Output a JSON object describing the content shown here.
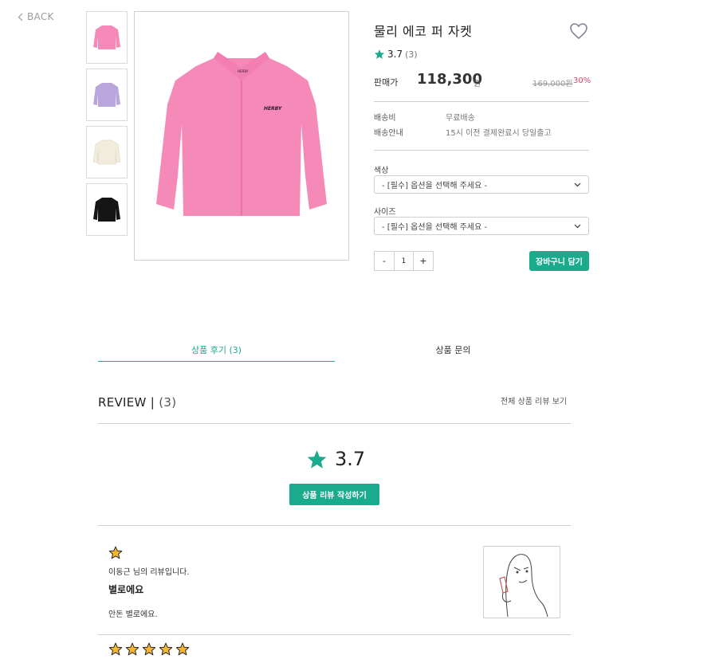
{
  "nav": {
    "back_label": "BACK"
  },
  "product": {
    "title": "물리 에코 퍼 자켓",
    "rating": "3.7",
    "review_count": "(3)",
    "price_label": "판매가",
    "price": "118,300",
    "price_unit": "원",
    "original_price": "169,000원",
    "discount": "30%",
    "thumbnails": [
      {
        "color_name": "pink",
        "color": "#f589b8"
      },
      {
        "color_name": "lavender",
        "color": "#b9a6dc"
      },
      {
        "color_name": "cream",
        "color": "#f2ecdc"
      },
      {
        "color_name": "black",
        "color": "#151515"
      }
    ]
  },
  "shipping": {
    "fee_label": "배송비",
    "fee_value": "무료배송",
    "guide_label": "배송안내",
    "guide_value": "15시 이전 결제완료시 당일출고"
  },
  "options": {
    "color_label": "색상",
    "color_placeholder": "- [필수] 옵션을 선택해 주세요 -",
    "size_label": "사이즈",
    "size_placeholder": "- [필수] 옵션을 선택해 주세요 -"
  },
  "quantity": {
    "minus": "-",
    "value": "1",
    "plus": "+"
  },
  "cart_button": "장바구니 담기",
  "tabs": [
    {
      "label": "상품 후기 (3)",
      "active": true
    },
    {
      "label": "상품 문의",
      "active": false
    }
  ],
  "review_section": {
    "heading": "REVIEW |",
    "count": "(3)",
    "view_all": "전체 상품 리뷰 보기",
    "average": "3.7",
    "write_button": "상품 리뷰 작성하기",
    "reviews": [
      {
        "stars": 1,
        "author": "이동근 님의 리뷰입니다.",
        "title": "별로에요",
        "body": "안돈 별로에요."
      },
      {
        "stars": 5
      }
    ]
  },
  "colors": {
    "accent": "#19ab8c",
    "discount": "#e0476b",
    "star_review": "#f5b731",
    "jacket_pink": "#f589b8"
  }
}
